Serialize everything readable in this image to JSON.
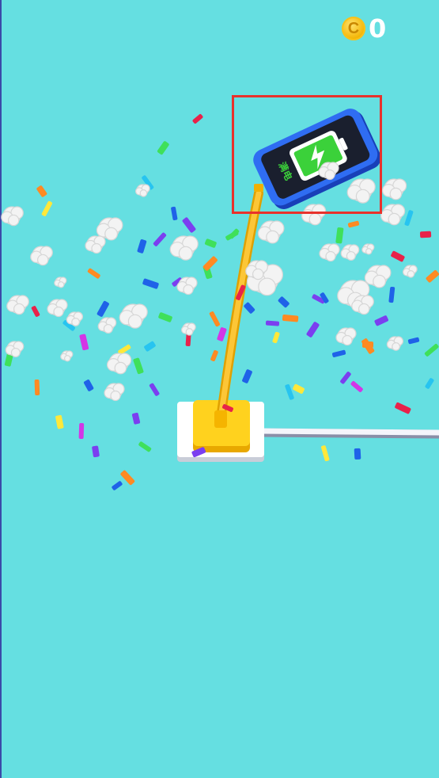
{
  "hud": {
    "coin_icon": "coin-icon",
    "coin_glyph": "C",
    "coins": "0"
  },
  "phone": {
    "status_text": "满电",
    "icon": "battery-charging-icon"
  },
  "colors": {
    "background": "#65dfe1",
    "highlight": "#e8322c",
    "cable": "#f9b71b",
    "plug": "#ffd21e",
    "phone_body": "#1f5be0",
    "battery": "#3bd13a"
  }
}
